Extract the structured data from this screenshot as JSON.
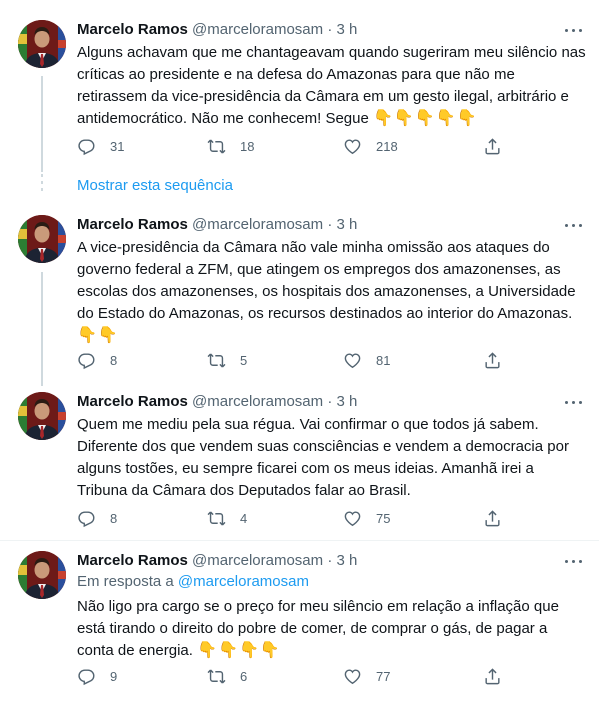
{
  "tweets": [
    {
      "name": "Marcelo Ramos",
      "handle": "@marceloramosam",
      "separator": "·",
      "time": "3 h",
      "text": "Alguns achavam que me chantageavam quando sugeriram meu silêncio nas críticas ao presidente e na defesa do Amazonas para que não me retirassem da vice-presidência da Câmara em um gesto ilegal, arbitrário e antidemocrático. Não me conhecem!  Segue ",
      "emojis": "👇👇👇👇👇",
      "replies": "31",
      "retweets": "18",
      "likes": "218"
    },
    {
      "name": "Marcelo Ramos",
      "handle": "@marceloramosam",
      "separator": "·",
      "time": "3 h",
      "text": "A vice-presidência da Câmara não vale minha omissão aos ataques do governo federal a ZFM, que atingem os empregos dos amazonenses, as escolas dos amazonenses, os hospitais dos amazonenses, a Universidade do Estado do Amazonas, os recursos destinados ao interior do Amazonas.",
      "emojis": "👇👇",
      "replies": "8",
      "retweets": "5",
      "likes": "81"
    },
    {
      "name": "Marcelo Ramos",
      "handle": "@marceloramosam",
      "separator": "·",
      "time": "3 h",
      "text": "Quem me mediu pela sua régua. Vai confirmar o que todos já sabem. Diferente dos que vendem suas consciências e vendem a democracia por alguns tostões, eu sempre ficarei com os meus ideias. Amanhã irei a Tribuna da Câmara dos Deputados falar ao Brasil.",
      "emojis": "",
      "replies": "8",
      "retweets": "4",
      "likes": "75"
    },
    {
      "name": "Marcelo Ramos",
      "handle": "@marceloramosam",
      "separator": "·",
      "time": "3 h",
      "reply_prefix": "Em resposta a ",
      "reply_to": "@marceloramosam",
      "text": "Não ligo pra cargo se o preço for meu silêncio em relação a inflação que está tirando o direito do pobre de comer, de comprar o gás, de pagar a conta de energia. ",
      "emojis": "👇👇👇👇",
      "replies": "9",
      "retweets": "6",
      "likes": "77"
    }
  ],
  "show_thread_label": "Mostrar esta sequência",
  "colors": {
    "text": "#0f1419",
    "secondary": "#536471",
    "link": "#1d9bf0",
    "divider": "#eff3f4"
  },
  "icons": [
    "reply-icon",
    "retweet-icon",
    "like-icon",
    "share-icon",
    "more-icon"
  ]
}
